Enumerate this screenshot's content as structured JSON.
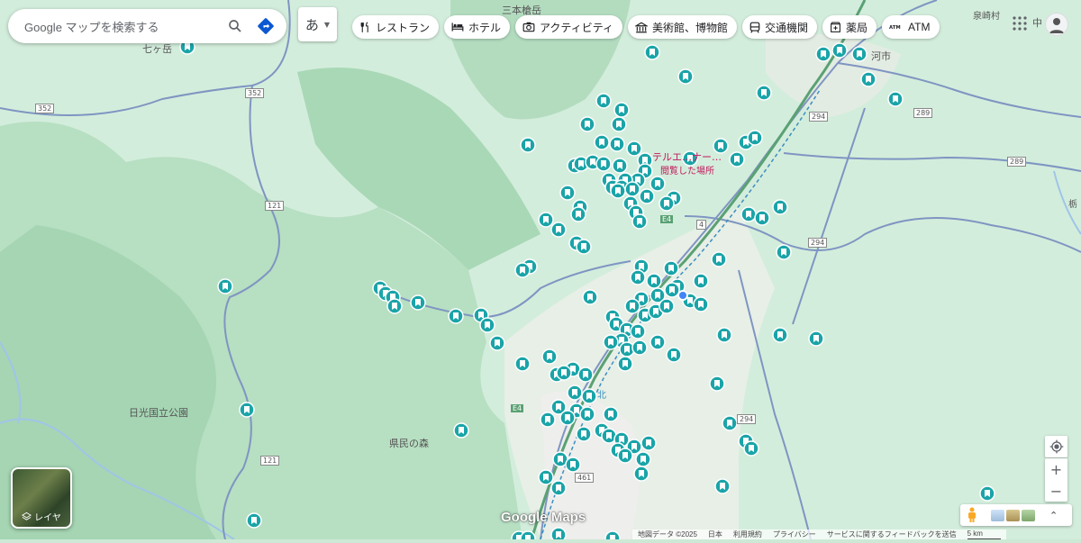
{
  "search": {
    "placeholder": "Google マップを検索する"
  },
  "ime": {
    "label": "あ"
  },
  "categories": [
    {
      "label": "レストラン",
      "icon": "restaurant-icon"
    },
    {
      "label": "ホテル",
      "icon": "hotel-icon"
    },
    {
      "label": "アクティビティ",
      "icon": "camera-icon"
    },
    {
      "label": "美術館、博物館",
      "icon": "museum-icon"
    },
    {
      "label": "交通機関",
      "icon": "transit-icon"
    },
    {
      "label": "薬局",
      "icon": "pharmacy-icon"
    },
    {
      "label": "ATM",
      "icon": "atm-icon"
    }
  ],
  "map_labels": {
    "nanatsugatake": "七ヶ岳",
    "sanbonyari": "三本槍岳",
    "nikko_park": "日光国立公園",
    "kenmin_forest": "県民の森",
    "izumizaki": "泉崎村",
    "hotel_highlight": "テルエ…ナー…",
    "viewed_place": "閲覧した場所",
    "shirakawa": "河市",
    "naka": "中",
    "e4_a": "E4",
    "e4_b": "E4",
    "r352": "352",
    "r352b": "352",
    "r121": "121",
    "r121b": "121",
    "r294": "294",
    "r294b": "294",
    "r294c": "294",
    "r289": "289",
    "r289b": "289",
    "r461": "461",
    "r4": "4",
    "kita": "北",
    "tochigi": "栃"
  },
  "layer": {
    "label": "レイヤ"
  },
  "logo": "Google Maps",
  "footer": {
    "data": "地図データ ©2025",
    "country": "日本",
    "terms": "利用規約",
    "privacy": "プライバシー",
    "feedback": "サービスに関するフィードバックを送信",
    "scale": "5 km"
  },
  "colors": {
    "marker": "#1aa4a8",
    "route": "#6f86b4",
    "park_green": "#b9e4c5"
  }
}
